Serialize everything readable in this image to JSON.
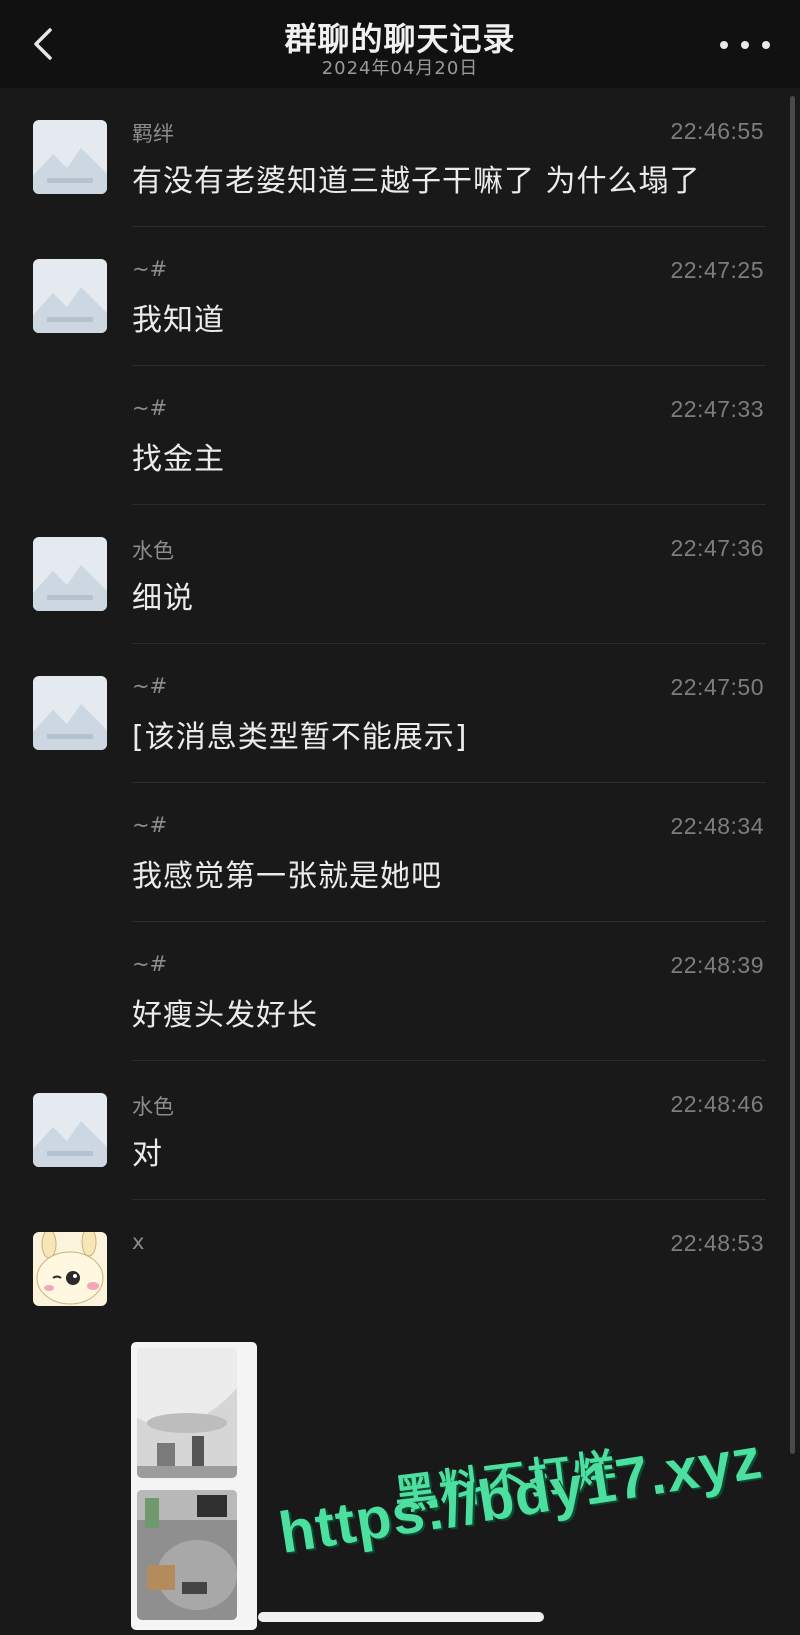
{
  "header": {
    "title": "群聊的聊天记录",
    "date": "2024年04月20日",
    "back_icon": "chevron-left-icon",
    "more_icon": "more-dots-icon"
  },
  "messages": [
    {
      "sender": "羁绊",
      "time": "22:46:55",
      "text": "有没有老婆知道三越子干嘛了 为什么塌了",
      "avatar": "placeholder"
    },
    {
      "sender": "~#",
      "time": "22:47:25",
      "text": "我知道",
      "avatar": "placeholder"
    },
    {
      "sender": "~#",
      "time": "22:47:33",
      "text": "找金主",
      "avatar": "none"
    },
    {
      "sender": "水色",
      "time": "22:47:36",
      "text": "细说",
      "avatar": "placeholder"
    },
    {
      "sender": "~#",
      "time": "22:47:50",
      "text": "[该消息类型暂不能展示]",
      "avatar": "placeholder"
    },
    {
      "sender": "~#",
      "time": "22:48:34",
      "text": "我感觉第一张就是她吧",
      "avatar": "none"
    },
    {
      "sender": "~#",
      "time": "22:48:39",
      "text": "好瘦头发好长",
      "avatar": "none"
    },
    {
      "sender": "水色",
      "time": "22:48:46",
      "text": "对",
      "avatar": "placeholder"
    },
    {
      "sender": "x",
      "time": "22:48:53",
      "text": "",
      "avatar": "cartoon",
      "attachment": "image-collage"
    }
  ],
  "watermark": {
    "line1": "黑料不打烊",
    "line2": "https://bdy17.xyz"
  },
  "colors": {
    "background": "#191919",
    "header": "#111111",
    "watermark": "#4ddfa0"
  }
}
